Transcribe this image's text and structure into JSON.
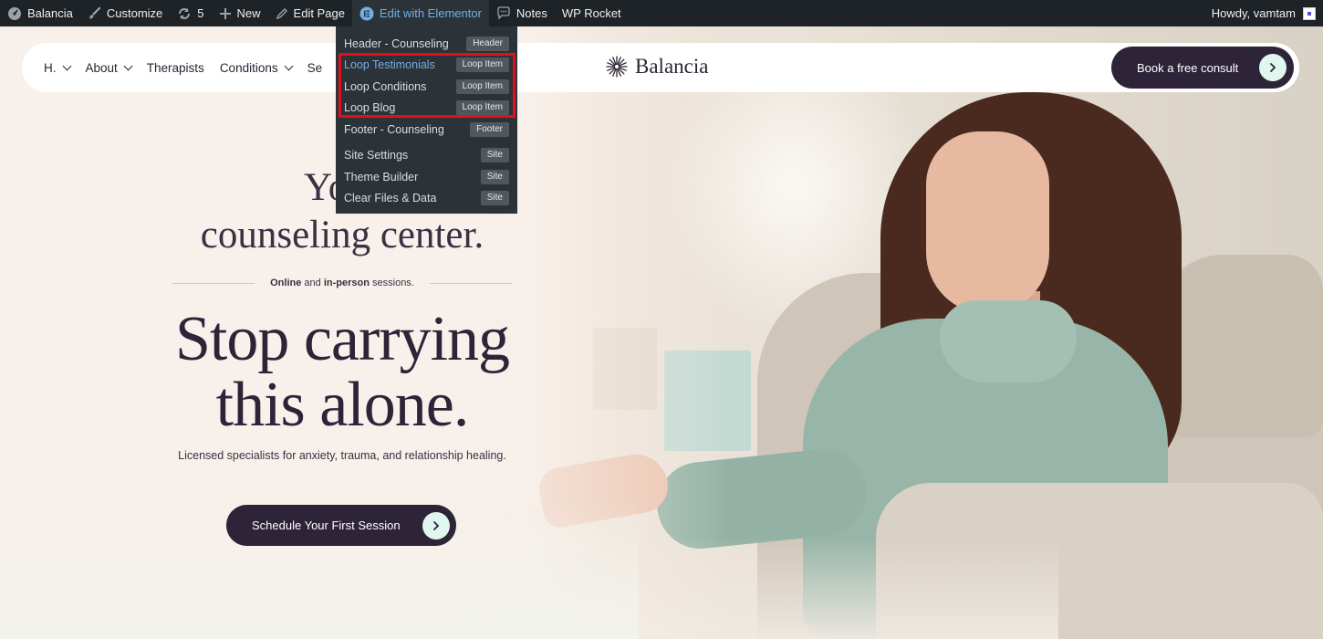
{
  "adminbar": {
    "site_name": "Balancia",
    "customize": "Customize",
    "updates_count": "5",
    "new": "New",
    "edit_page": "Edit Page",
    "edit_elementor": "Edit with Elementor",
    "notes": "Notes",
    "wp_rocket": "WP Rocket",
    "howdy": "Howdy, vamtam"
  },
  "dropdown": {
    "items": [
      {
        "label": "Header - Counseling",
        "badge": "Header"
      },
      {
        "label": "Loop Testimonials",
        "badge": "Loop Item"
      },
      {
        "label": "Loop Conditions",
        "badge": "Loop Item"
      },
      {
        "label": "Loop Blog",
        "badge": "Loop Item"
      },
      {
        "label": "Footer - Counseling",
        "badge": "Footer"
      },
      {
        "label": "Site Settings",
        "badge": "Site"
      },
      {
        "label": "Theme Builder",
        "badge": "Site"
      },
      {
        "label": "Clear Files & Data",
        "badge": "Site"
      }
    ]
  },
  "header": {
    "nav": [
      {
        "label": "H."
      },
      {
        "label": "About"
      },
      {
        "label": "Therapists"
      },
      {
        "label": "Conditions"
      },
      {
        "label": "Se"
      }
    ],
    "logo": "Balancia",
    "cta": "Book a free consult"
  },
  "hero": {
    "eyebrow_line1": "Your",
    "eyebrow_line2": "counseling center.",
    "divider_bold1": "Online",
    "divider_mid": " and ",
    "divider_bold2": "in-person",
    "divider_end": " sessions.",
    "headline_line1": "Stop carrying",
    "headline_line2": "this alone.",
    "subline": "Licensed specialists for anxiety, trauma, and relationship healing.",
    "button": "Schedule Your First Session"
  },
  "colors": {
    "admin_bg": "#1d2327",
    "admin_active": "#72aee6",
    "brand_dark": "#2e2438",
    "accent_mint": "#dff7ee",
    "highlight_red": "#e3101a"
  }
}
